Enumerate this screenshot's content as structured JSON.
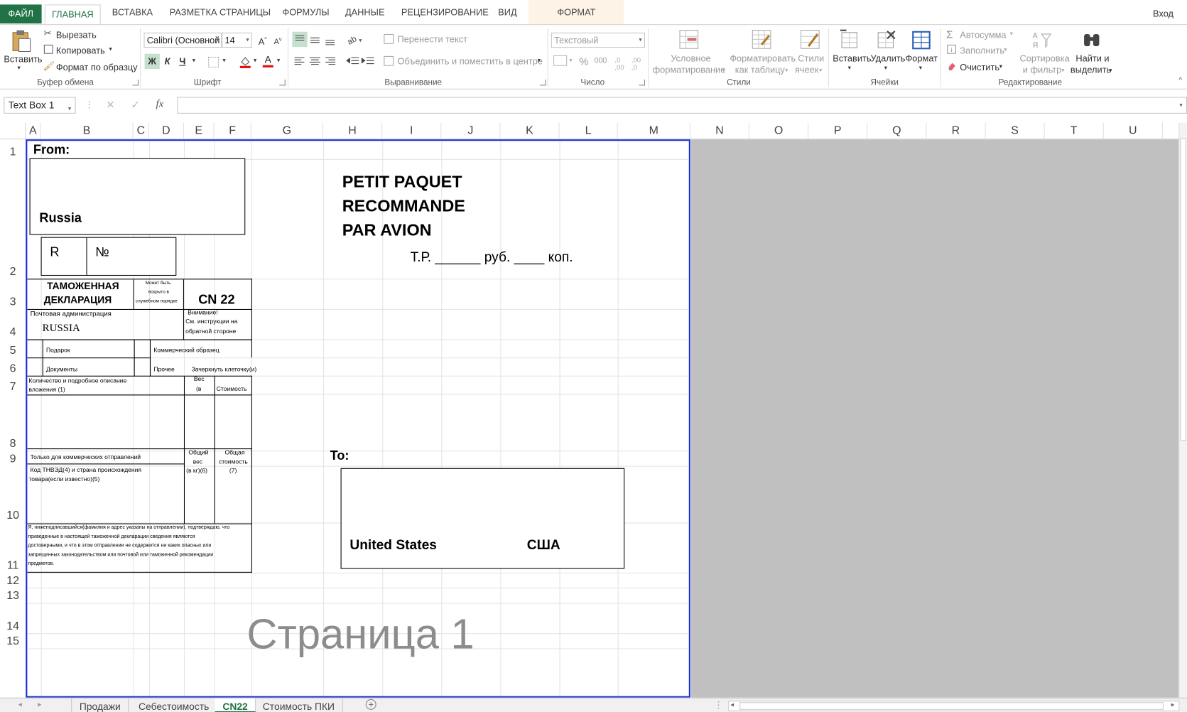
{
  "ribbon_tabs": {
    "file": "ФАЙЛ",
    "home": "ГЛАВНАЯ",
    "insert": "ВСТАВКА",
    "page_layout": "РАЗМЕТКА СТРАНИЦЫ",
    "formulas": "ФОРМУЛЫ",
    "data": "ДАННЫЕ",
    "review": "РЕЦЕНЗИРОВАНИЕ",
    "view": "ВИД",
    "format": "ФОРМАТ",
    "signin": "Вход"
  },
  "clipboard": {
    "paste": "Вставить",
    "cut": "Вырезать",
    "copy": "Копировать",
    "format_painter": "Формат по образцу",
    "group": "Буфер обмена"
  },
  "font": {
    "name": "Calibri (Основной",
    "size": "14",
    "bold": "Ж",
    "italic": "К",
    "underline": "Ч",
    "group": "Шрифт"
  },
  "alignment": {
    "wrap_text": "Перенести текст",
    "merge_center": "Объединить и поместить в центре",
    "group": "Выравнивание"
  },
  "number": {
    "format": "Текстовый",
    "percent": "%",
    "thousands": "000",
    "group": "Число"
  },
  "styles": {
    "conditional_1": "Условное",
    "conditional_2": "форматирование",
    "as_table_1": "Форматировать",
    "as_table_2": "как таблицу",
    "cell_styles_1": "Стили",
    "cell_styles_2": "ячеек",
    "group": "Стили"
  },
  "cells": {
    "insert": "Вставить",
    "delete": "Удалить",
    "format": "Формат",
    "group": "Ячейки"
  },
  "editing": {
    "autosum": "Автосумма",
    "fill": "Заполнить",
    "clear": "Очистить",
    "sort_1": "Сортировка",
    "sort_2": "и фильтр",
    "find_1": "Найти и",
    "find_2": "выделить",
    "group": "Редактирование"
  },
  "formula_bar": {
    "name_box": "Text Box 1",
    "fx": "fx",
    "value": ""
  },
  "columns": [
    "A",
    "B",
    "C",
    "D",
    "E",
    "F",
    "G",
    "H",
    "I",
    "J",
    "K",
    "L",
    "M",
    "N",
    "O",
    "P",
    "Q",
    "R",
    "S",
    "T",
    "U"
  ],
  "rows": [
    "1",
    "2",
    "3",
    "4",
    "5",
    "6",
    "7",
    "8",
    "9",
    "10",
    "11",
    "12",
    "13",
    "14",
    "15"
  ],
  "form": {
    "from": "From:",
    "from_country": "Russia",
    "r_label": "R",
    "no_label": "№",
    "title_1": "PETIT  PAQUET",
    "title_2": "RECOMMANDE",
    "title_3": "PAR AVION",
    "tr_line": "Т.Р. ______ руб. ____ коп.",
    "customs_1": "ТАМОЖЕННАЯ",
    "customs_2": "ДЕКЛАРАЦИЯ",
    "may_open_1": "Может быть",
    "may_open_2": "вскрыто в",
    "may_open_3": "служебном порядке",
    "cn22": "CN 22",
    "postal_admin": "Почтовая администрация",
    "postal_country": "RUSSIA",
    "attention_1": "Внимание!",
    "attention_2": "См. инструкции на",
    "attention_3": "обратной стороне",
    "gift": "Подарок",
    "commercial_sample": "Коммерческий образец",
    "documents": "Документы",
    "other": "Прочее",
    "cross_out": "Зачеркнуть клеточку(и)",
    "qty_desc_1": "Количество и подробное описание",
    "qty_desc_2": "вложения (1)",
    "weight_1": "Вес",
    "weight_2": "(в",
    "value_col": "Стоимость",
    "commercial_only": "Только для коммерческих отправлений",
    "total_weight_1": "Общий",
    "total_weight_2": "вес",
    "total_weight_3": "(в кг)(6)",
    "total_value_1": "Общая",
    "total_value_2": "стоимость",
    "total_value_3": "(7)",
    "hs_code_1": "Код ТНВЭД(4) и страна происхождения",
    "hs_code_2": "товара(если известно)(5)",
    "declaration_1": "Я, нижеподписавшийся(фамилия и адрес указаны на отправлении), подтверждаю, что",
    "declaration_2": "приведенные в настоящей таможенной декларации сведения являются",
    "declaration_3": "достоверными, и что в этом отправлении не содержится ни каких опасных или",
    "declaration_4": "запрещенных законодательством или почтовой или таможенной рекомендации",
    "declaration_5": "предметов.",
    "to": "To:",
    "to_country_en": "United States",
    "to_country_ru": "США",
    "watermark": "Страница 1"
  },
  "sheet_tabs": [
    "Продажи",
    "Себестоимость",
    "CN22",
    "Стоимость ПКИ"
  ],
  "active_sheet": "CN22",
  "colors": {
    "accent": "#217346",
    "page_border": "#1a2ed6",
    "outside_area": "#c0c0c0"
  }
}
